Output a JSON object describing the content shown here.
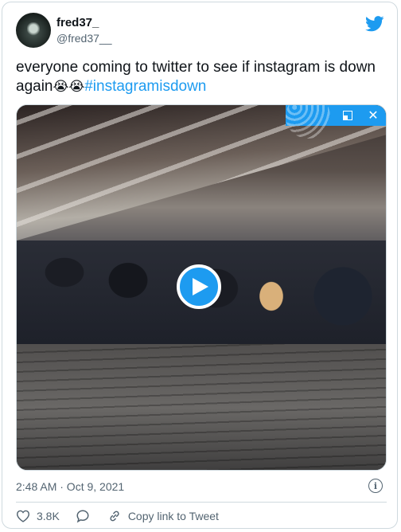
{
  "author": {
    "name": "fred37_",
    "handle": "@fred37__"
  },
  "tweet": {
    "text": "everyone coming to twitter to see if instagram is down again",
    "emojis": "😭😭",
    "hashtag": "#instagramisdown"
  },
  "meta": {
    "timestamp": "2:48 AM · Oct 9, 2021"
  },
  "actions": {
    "likes": "3.8K",
    "copy_link": "Copy link to Tweet"
  },
  "colors": {
    "accent": "#1d9bf0",
    "text": "#0f1419",
    "secondary": "#536471",
    "border": "#cfd9de"
  },
  "icons": {
    "brand": "twitter-bird-icon",
    "play": "play-icon",
    "pip_expand": "expand-icon",
    "pip_close": "close-icon",
    "info": "info-icon",
    "like": "heart-icon",
    "reply": "reply-icon",
    "link": "link-icon"
  }
}
